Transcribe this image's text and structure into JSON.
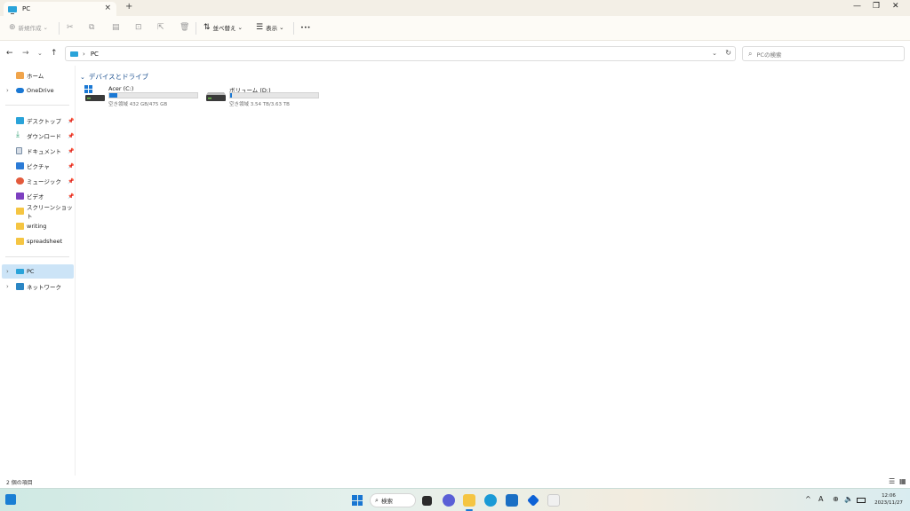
{
  "window": {
    "tab_title": "PC",
    "close_glyph": "×",
    "newtab_glyph": "+",
    "min_glyph": "—",
    "max_glyph": "❐",
    "winclose_glyph": "✕"
  },
  "toolbar": {
    "new_label": "新規作成",
    "sort_label": "並べ替え",
    "view_label": "表示",
    "more_glyph": "•••"
  },
  "address": {
    "path_segment": "PC",
    "search_placeholder": "PCの検索"
  },
  "sidebar": {
    "home": "ホーム",
    "onedrive": "OneDrive",
    "pinned": [
      {
        "label": "デスクトップ",
        "icon": "desktop-icon",
        "color": "#2aa3d9"
      },
      {
        "label": "ダウンロード",
        "icon": "download-icon",
        "color": "#2a9d6f"
      },
      {
        "label": "ドキュメント",
        "icon": "document-icon",
        "color": "#7a8fa6"
      },
      {
        "label": "ピクチャ",
        "icon": "pictures-icon",
        "color": "#2b7bd6"
      },
      {
        "label": "ミュージック",
        "icon": "music-icon",
        "color": "#e35a3c"
      },
      {
        "label": "ビデオ",
        "icon": "video-icon",
        "color": "#7d3fc0"
      }
    ],
    "folders": [
      "スクリーンショット",
      "writing",
      "spreadsheet"
    ],
    "pc": "PC",
    "network": "ネットワーク"
  },
  "content": {
    "group_title": "デバイスとドライブ",
    "drives": [
      {
        "name": "Acer (C:)",
        "space": "空き領域 432 GB/475 GB",
        "used_fraction": 0.09
      },
      {
        "name": "ボリューム (D:)",
        "space": "空き領域 3.54 TB/3.63 TB",
        "used_fraction": 0.025
      }
    ]
  },
  "status": {
    "item_count": "2 個の項目"
  },
  "taskbar": {
    "search_label": "検索",
    "time": "12:06",
    "date": "2023/11/27",
    "ime": "A"
  },
  "colors": {
    "accent": "#1a78d4",
    "selected_bg": "#cce4f7",
    "group_title": "#1b4f8f"
  }
}
